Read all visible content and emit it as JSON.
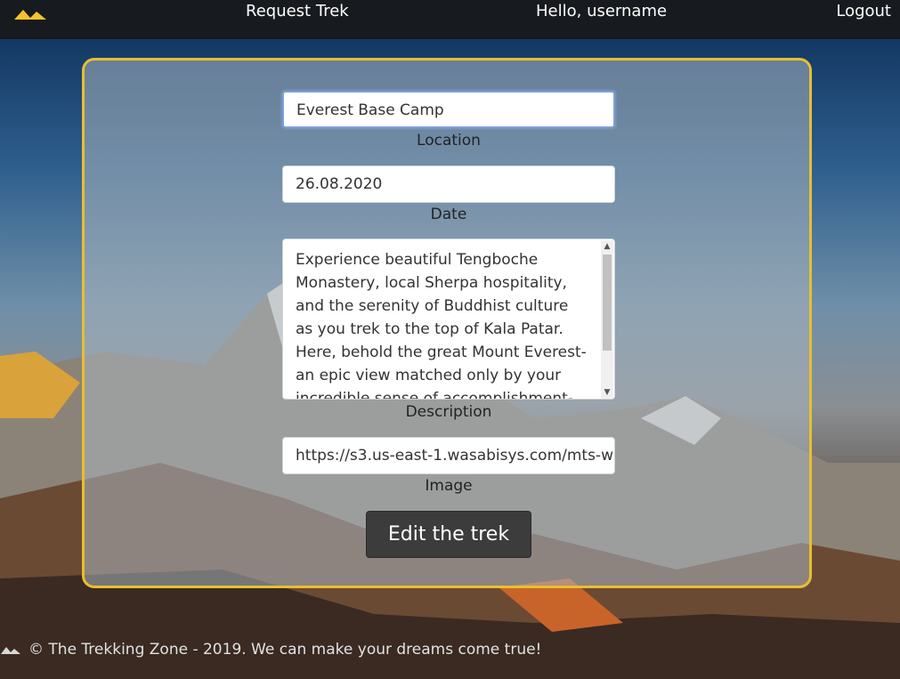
{
  "nav": {
    "logo_icon": "mountain-logo-icon",
    "request_label": "Request Trek",
    "greeting": "Hello, username",
    "logout_label": "Logout"
  },
  "form": {
    "location_value": "Everest Base Camp",
    "location_label": "Location",
    "date_value": "26.08.2020",
    "date_label": "Date",
    "description_value": "Experience beautiful Tengboche Monastery, local Sherpa hospitality, and the serenity of Buddhist culture as you trek to the top of Kala Patar. Here, behold the great Mount Everest-an epic view matched only by your incredible sense of accomplishment-before",
    "description_label": "Description",
    "image_value": "https://s3.us-east-1.wasabisys.com/mts-w",
    "image_label": "Image",
    "submit_label": "Edit the trek"
  },
  "footer": {
    "logo_icon": "mountain-logo-icon",
    "text": "© The Trekking Zone - 2019. We can make your dreams come true!"
  },
  "colors": {
    "accent": "#e8bf2e",
    "navbar": "#171a1f",
    "button": "#3c3c3c"
  }
}
